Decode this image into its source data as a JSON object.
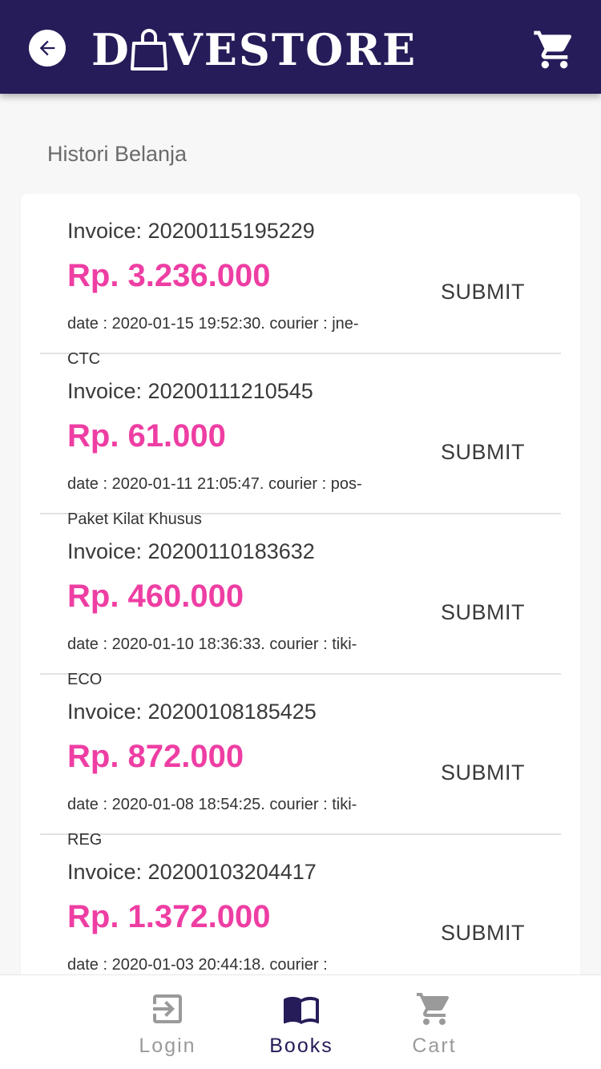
{
  "header": {
    "logo_before": "D",
    "logo_after": "VESTORE",
    "back_icon": "arrow-back-icon",
    "cart_icon": "shopping-cart-icon",
    "background": "#251c59"
  },
  "page": {
    "title": "Histori Belanja"
  },
  "orders": [
    {
      "invoice": "Invoice: 20200115195229",
      "price": "Rp. 3.236.000",
      "meta": "date : 2020-01-15 19:52:30. courier : jne-CTC",
      "action": "SUBMIT"
    },
    {
      "invoice": "Invoice: 20200111210545",
      "price": "Rp. 61.000",
      "meta": "date : 2020-01-11 21:05:47. courier : pos-Paket Kilat Khusus",
      "action": "SUBMIT"
    },
    {
      "invoice": "Invoice: 20200110183632",
      "price": "Rp. 460.000",
      "meta": "date : 2020-01-10 18:36:33. courier : tiki-ECO",
      "action": "SUBMIT"
    },
    {
      "invoice": "Invoice: 20200108185425",
      "price": "Rp. 872.000",
      "meta": "date : 2020-01-08 18:54:25. courier : tiki-REG",
      "action": "SUBMIT"
    },
    {
      "invoice": "Invoice: 20200103204417",
      "price": "Rp. 1.372.000",
      "meta": "date : 2020-01-03 20:44:18. courier :",
      "action": "SUBMIT"
    }
  ],
  "nav": {
    "items": [
      {
        "label": "Login",
        "icon": "login-icon",
        "active": false
      },
      {
        "label": "Books",
        "icon": "book-icon",
        "active": true
      },
      {
        "label": "Cart",
        "icon": "shopping-cart-icon",
        "active": false
      }
    ],
    "active_color": "#251c59",
    "inactive_color": "#9a9a9a"
  },
  "colors": {
    "price": "#ee3ea3",
    "accent": "#251c59"
  }
}
